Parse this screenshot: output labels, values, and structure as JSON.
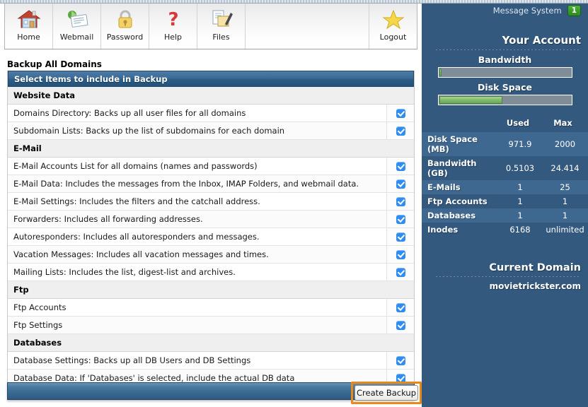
{
  "toolbar": {
    "items": [
      {
        "label": "Home",
        "icon": "house-icon"
      },
      {
        "label": "Webmail",
        "icon": "envelope-icon"
      },
      {
        "label": "Password",
        "icon": "padlock-icon"
      },
      {
        "label": "Help",
        "icon": "question-mark-icon"
      },
      {
        "label": "Files",
        "icon": "documents-pencil-icon"
      }
    ],
    "logout": {
      "label": "Logout",
      "icon": "star-icon"
    }
  },
  "page": {
    "title": "Backup All Domains",
    "panel_header": "Select Items to include in Backup",
    "create_button": "Create Backup"
  },
  "sections": [
    {
      "heading": "Website Data",
      "rows": [
        {
          "label": "Domains Directory: Backs up all user files for all domains",
          "checked": true
        },
        {
          "label": "Subdomain Lists: Backs up the list of subdomains for each domain",
          "checked": true
        }
      ]
    },
    {
      "heading": "E-Mail",
      "rows": [
        {
          "label": "E-Mail Accounts List for all domains (names and passwords)",
          "checked": true
        },
        {
          "label": "E-Mail Data: Includes the messages from the Inbox, IMAP Folders, and webmail data.",
          "checked": true
        },
        {
          "label": "E-Mail Settings: Includes the filters and the catchall address.",
          "checked": true
        },
        {
          "label": "Forwarders: Includes all forwarding addresses.",
          "checked": true
        },
        {
          "label": "Autoresponders: Includes all autoresponders and messages.",
          "checked": true
        },
        {
          "label": "Vacation Messages: Includes all vacation messages and times.",
          "checked": true
        },
        {
          "label": "Mailing Lists: Includes the list, digest-list and archives.",
          "checked": true
        }
      ]
    },
    {
      "heading": "Ftp",
      "rows": [
        {
          "label": "Ftp Accounts",
          "checked": true
        },
        {
          "label": "Ftp Settings",
          "checked": true
        }
      ]
    },
    {
      "heading": "Databases",
      "rows": [
        {
          "label": "Database Settings: Backs up all DB Users and DB Settings",
          "checked": true
        },
        {
          "label": "Database Data: If 'Databases' is selected, include the actual DB data",
          "checked": true
        }
      ]
    }
  ],
  "sidebar": {
    "message_system_label": "Message System",
    "message_count": "1",
    "account_heading": "Your Account",
    "bandwidth_label": "Bandwidth",
    "bandwidth_percent": 2,
    "diskspace_label": "Disk Space",
    "diskspace_percent": 48,
    "table": {
      "headers": [
        "",
        "Used",
        "Max"
      ],
      "rows": [
        {
          "name": "Disk Space (MB)",
          "used": "971.9",
          "max": "2000"
        },
        {
          "name": "Bandwidth (GB)",
          "used": "0.5103",
          "max": "24.414"
        },
        {
          "name": "E-Mails",
          "used": "1",
          "max": "25"
        },
        {
          "name": "Ftp Accounts",
          "used": "1",
          "max": "1"
        },
        {
          "name": "Databases",
          "used": "1",
          "max": "1"
        },
        {
          "name": "Inodes",
          "used": "6168",
          "max": "unlimited"
        }
      ]
    },
    "current_domain_heading": "Current Domain",
    "current_domain": "movietrickster.com"
  },
  "colors": {
    "sidebar_bg": "#33597f",
    "sidebar_row_alt": "#3f6890",
    "panel_header_blue": "#2d5c85",
    "checkbox_blue": "#2f8cf0",
    "badge_green": "#2e8a1f",
    "highlight_orange": "#e8891c",
    "progress_green": "#7fbb6c"
  }
}
